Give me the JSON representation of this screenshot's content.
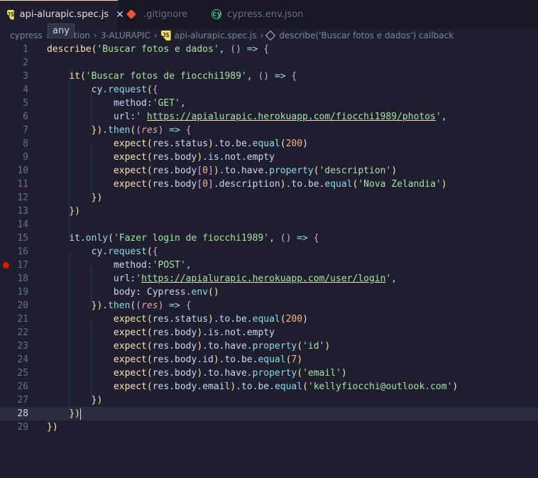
{
  "tabs": [
    {
      "label": "api-alurapic.spec.js",
      "icon": "js-icon",
      "active": true
    },
    {
      "label": ".gitignore",
      "icon": "git-icon",
      "active": false
    },
    {
      "label": "cypress.env.json",
      "icon": "cypress-icon",
      "active": false
    }
  ],
  "tooltip": "any",
  "breadcrumb": [
    "cypress",
    "ation",
    "3-ALURAPIC",
    "api-alurapic.spec.js",
    "describe('Buscar fotos e dados') callback"
  ],
  "editor": {
    "current_line": 28,
    "breakpoint_line": 17,
    "line_numbers": [
      "1",
      "2",
      "3",
      "4",
      "5",
      "6",
      "7",
      "8",
      "9",
      "10",
      "11",
      "12",
      "13",
      "14",
      "15",
      "16",
      "17",
      "18",
      "19",
      "20",
      "21",
      "22",
      "23",
      "24",
      "25",
      "26",
      "27",
      "28",
      "29"
    ],
    "lines": [
      "describe('Buscar fotos e dados', () => {",
      "",
      "    it('Buscar fotos de fiocchi1989', () => {",
      "        cy.request({",
      "            method:'GET',",
      "            url:' https://apialurapic.herokuapp.com/fiocchi1989/photos',",
      "        }).then((res) => {",
      "            expect(res.status).to.be.equal(200)",
      "            expect(res.body).is.not.empty",
      "            expect(res.body[0]).to.have.property('description')",
      "            expect(res.body[0].description).to.be.equal('Nova Zelandia')",
      "        })",
      "    })",
      "",
      "    it.only('Fazer login de fiocchi1989', () => {",
      "        cy.request({",
      "            method:'POST',",
      "            url:'https://apialurapic.herokuapp.com/user/login',",
      "            body: Cypress.env()",
      "        }).then((res) => {",
      "            expect(res.status).to.be.equal(200)",
      "            expect(res.body).is.not.empty",
      "            expect(res.body).to.have.property('id')",
      "            expect(res.body.id).to.be.equal(7)",
      "            expect(res.body).to.have.property('email')",
      "            expect(res.body.email).to.be.equal('kellyfiocchi@outlook.com')",
      "        })",
      "    })",
      "})"
    ]
  }
}
